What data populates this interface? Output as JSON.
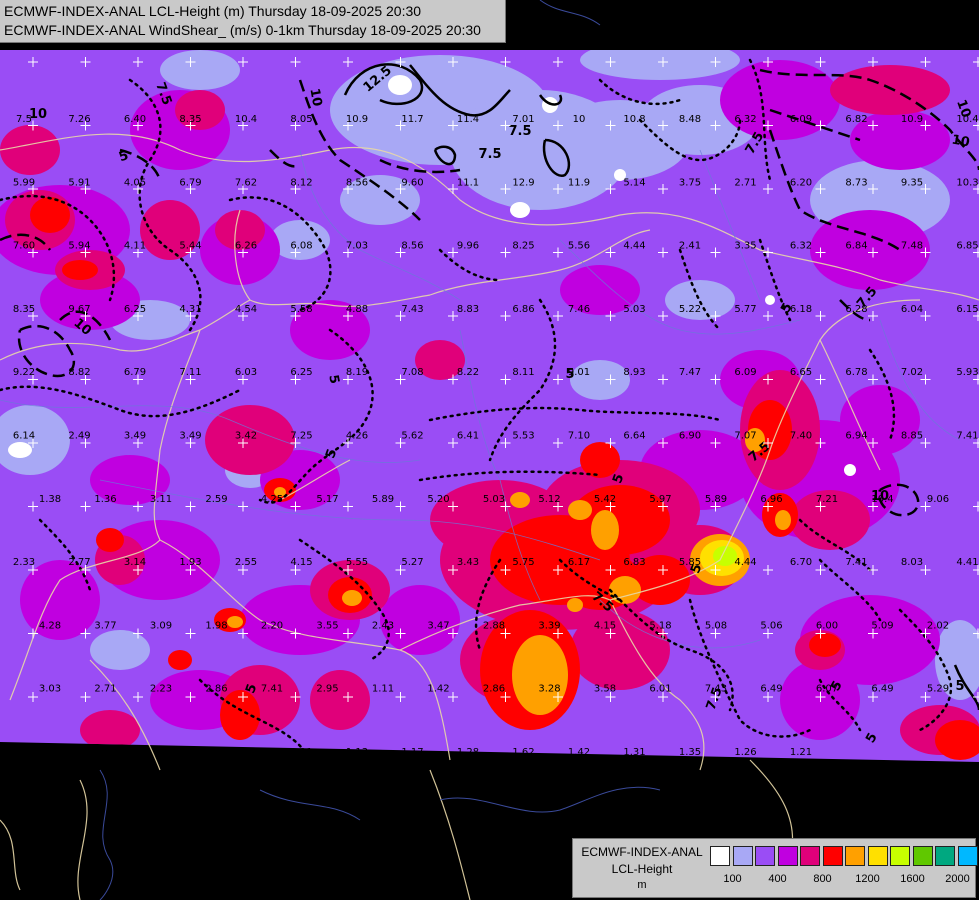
{
  "title": {
    "line1": "ECMWF-INDEX-ANAL LCL-Height (m) Thursday 18-09-2025 20:30",
    "line2": "ECMWF-INDEX-ANAL WindShear_ (m/s) 0-1km Thursday 18-09-2025 20:30"
  },
  "legend": {
    "name": "ECMWF-INDEX-ANAL",
    "field": "LCL-Height",
    "unit": "m",
    "colors": [
      "#ffffff",
      "#a8a8f5",
      "#9a4df5",
      "#c000e0",
      "#e0007a",
      "#ff0000",
      "#ffa000",
      "#ffe000",
      "#c8ff00",
      "#60c800",
      "#00a880",
      "#00b8ff"
    ],
    "tick_labels": [
      {
        "label": "100",
        "pos": 1
      },
      {
        "label": "400",
        "pos": 3
      },
      {
        "label": "800",
        "pos": 5
      },
      {
        "label": "1200",
        "pos": 7
      },
      {
        "label": "1600",
        "pos": 9
      },
      {
        "label": "2000",
        "pos": 11
      }
    ]
  },
  "map": {
    "field_colors": {
      "light": "#a8a8f5",
      "violet": "#9a4df5",
      "purple": "#c000e0",
      "magenta": "#e0007a",
      "red": "#ff0000",
      "orange": "#ffa000",
      "yellow": "#ffe000",
      "lime": "#c8ff00"
    },
    "contour_labels": [
      "12.5",
      "10",
      "7.5",
      "7.5",
      "10",
      "7.5",
      "5",
      "7.5",
      "10",
      "10",
      "7.5",
      "5",
      "5",
      "5",
      "7.5",
      "5",
      "7.5",
      "5",
      "5",
      "10",
      "7.5",
      "5",
      "10",
      "5",
      "5",
      "5"
    ],
    "grid_values": [
      [
        "7.5",
        "7.26",
        "6.40",
        "8.35",
        "10.4",
        "8.05",
        "10.9",
        "11.7",
        "11.4",
        "7.01",
        "10",
        "10.8",
        "8.48",
        "6.32",
        "6.09",
        "6.82",
        "10.9",
        "10.4"
      ],
      [
        "5.99",
        "5.91",
        "4.05",
        "6.79",
        "7.62",
        "8.12",
        "8.56",
        "9.60",
        "11.1",
        "12.9",
        "11.9",
        "5.14",
        "3.75",
        "2.71",
        "6.20",
        "8.73",
        "9.35",
        "10.3"
      ],
      [
        "7.60",
        "5.94",
        "4.11",
        "5.44",
        "6.26",
        "6.08",
        "7.03",
        "8.56",
        "9.96",
        "8.25",
        "5.56",
        "4.44",
        "2.41",
        "3.35",
        "6.32",
        "6.84",
        "7.48",
        "6.85"
      ],
      [
        "8.35",
        "9.67",
        "6.25",
        "4.31",
        "4.54",
        "5.58",
        "4.88",
        "7.43",
        "8.83",
        "6.86",
        "7.46",
        "5.03",
        "5.22",
        "5.77",
        "6.18",
        "6.28",
        "6.04",
        "6.15"
      ],
      [
        "9.22",
        "8.82",
        "6.79",
        "7.11",
        "6.03",
        "6.25",
        "8.19",
        "7.08",
        "8.22",
        "8.11",
        "9.01",
        "8.93",
        "7.47",
        "6.09",
        "6.65",
        "6.78",
        "7.02",
        "5.93"
      ],
      [
        "6.14",
        "2.49",
        "3.49",
        "3.49",
        "3.42",
        "7.25",
        "4.26",
        "5.62",
        "6.41",
        "5.53",
        "7.10",
        "6.64",
        "6.90",
        "7.07",
        "7.40",
        "6.94",
        "8.85",
        "7.41"
      ],
      [
        "1.38",
        "1.36",
        "3.11",
        "2.59",
        "4.25",
        "5.17",
        "5.89",
        "5.20",
        "5.03",
        "5.12",
        "5.42",
        "5.97",
        "5.89",
        "6.96",
        "7.21",
        "10.4",
        "9.06"
      ],
      [
        "2.33",
        "2.77",
        "3.14",
        "1.93",
        "2.55",
        "4.15",
        "5.55",
        "5.27",
        "3.43",
        "5.75",
        "6.17",
        "6.83",
        "5.85",
        "4.44",
        "6.70",
        "7.41",
        "8.03",
        "4.41"
      ],
      [
        "4.28",
        "3.77",
        "3.09",
        "1.98",
        "2.20",
        "3.55",
        "2.43",
        "3.47",
        "2.88",
        "3.39",
        "4.15",
        "5.18",
        "5.08",
        "5.06",
        "6.00",
        "5.09",
        "2.02"
      ],
      [
        "3.03",
        "2.71",
        "2.23",
        "2.86",
        "7.41",
        "2.95",
        "1.11",
        "1.42",
        "2.86",
        "3.28",
        "3.58",
        "6.01",
        "7.43",
        "6.49",
        "6.07",
        "6.49",
        "5.29"
      ],
      [
        "2.17",
        "2.12",
        "1.17",
        "1.28",
        "0.55",
        "1.11",
        "1.13",
        "1.17",
        "1.28",
        "1.62",
        "1.42",
        "1.31",
        "1.35",
        "1.26",
        "1.21"
      ]
    ]
  }
}
